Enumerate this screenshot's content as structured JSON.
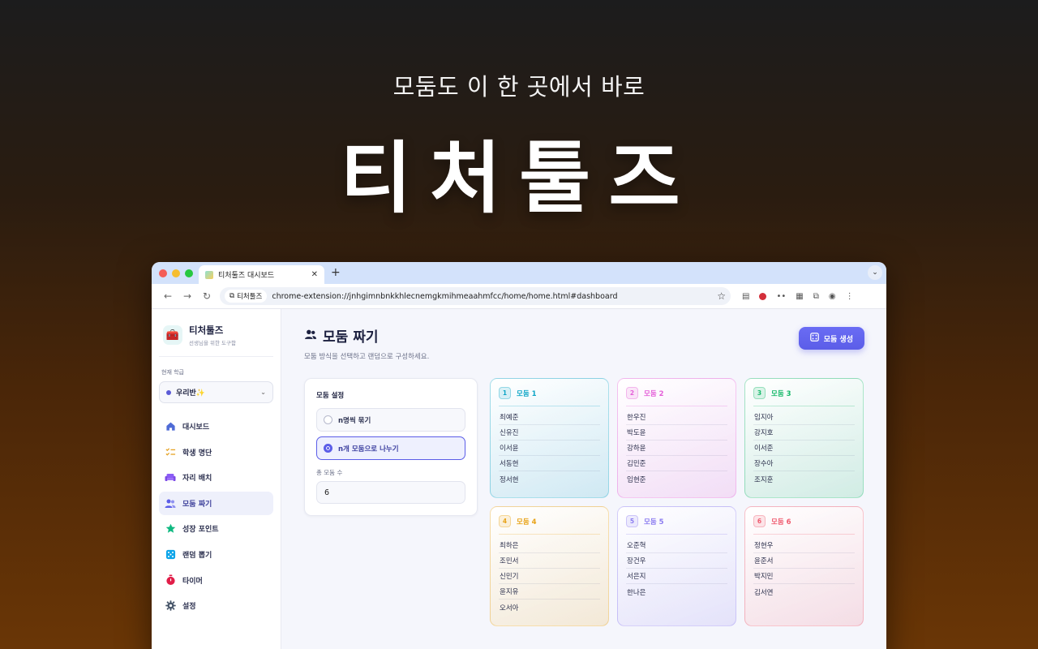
{
  "hero": {
    "subtitle": "모둠도 이 한 곳에서 바로",
    "title": "티처툴즈"
  },
  "browser": {
    "tab_title": "티처툴즈 대시보드",
    "new_tab": "+",
    "extension_chip": "티처툴즈",
    "url": "chrome-extension://jnhgimnbnkkhlecnemgkmihmeaahmfcc/home/home.html#dashboard"
  },
  "sidebar": {
    "brand_name": "티처툴즈",
    "brand_desc": "선생님을 위한 도구함",
    "class_label": "현재 학급",
    "class_value": "우리반✨",
    "items": [
      {
        "label": "대시보드",
        "icon": "home-icon",
        "color": "#4f6bd6"
      },
      {
        "label": "학생 명단",
        "icon": "checklist-icon",
        "color": "#e5a326"
      },
      {
        "label": "자리 배치",
        "icon": "sofa-icon",
        "color": "#8b5cf6"
      },
      {
        "label": "모둠 짜기",
        "icon": "users-icon",
        "color": "#5b5de8"
      },
      {
        "label": "성장 포인트",
        "icon": "star-icon",
        "color": "#10b981"
      },
      {
        "label": "랜덤 뽑기",
        "icon": "dice-icon",
        "color": "#0ea5e9"
      },
      {
        "label": "타이머",
        "icon": "stopwatch-icon",
        "color": "#e11d48"
      },
      {
        "label": "설정",
        "icon": "gear-icon",
        "color": "#475569"
      }
    ]
  },
  "main": {
    "title": "모둠 짜기",
    "description": "모둠 방식을 선택하고 랜덤으로 구성하세요.",
    "generate_button": "모둠 생성",
    "settings": {
      "title": "모둠 설정",
      "option_1": "n명씩 묶기",
      "option_2": "n개 모둠으로 나누기",
      "count_label": "총 모둠 수",
      "count_value": "6"
    },
    "groups": [
      {
        "number": "1",
        "name": "모둠 1",
        "color": "#0ea5c6",
        "members": [
          "최예준",
          "신유진",
          "이서윤",
          "서동현",
          "정서현"
        ]
      },
      {
        "number": "2",
        "name": "모둠 2",
        "color": "#e45fd8",
        "members": [
          "한우진",
          "박도윤",
          "강하윤",
          "김민준",
          "임현준"
        ]
      },
      {
        "number": "3",
        "name": "모둠 3",
        "color": "#16b96a",
        "members": [
          "임지아",
          "강지호",
          "이서준",
          "장수아",
          "조지훈"
        ]
      },
      {
        "number": "4",
        "name": "모둠 4",
        "color": "#e8a317",
        "members": [
          "최하은",
          "조민서",
          "신민기",
          "윤지유",
          "오서아"
        ]
      },
      {
        "number": "5",
        "name": "모둠 5",
        "color": "#8b7cf0",
        "members": [
          "오준혁",
          "장건우",
          "서은지",
          "한나은"
        ]
      },
      {
        "number": "6",
        "name": "모둠 6",
        "color": "#ef5b6f",
        "members": [
          "정현우",
          "윤준서",
          "박지민",
          "김서연"
        ]
      }
    ]
  }
}
